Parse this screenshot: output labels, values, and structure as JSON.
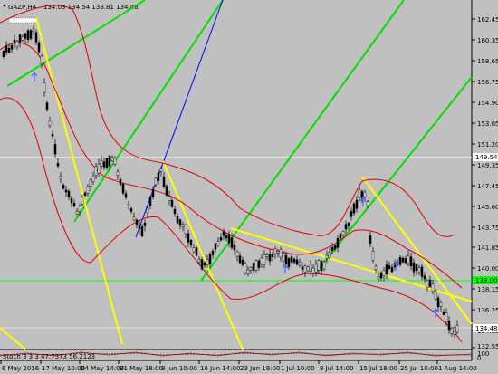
{
  "window": {
    "title": "GAZP,H4",
    "ohlc": "134.09 134.54 133.81 134.48"
  },
  "indicator": {
    "label": "Stoch 3 3 3 47.7573 56.2123"
  },
  "price_axis": {
    "ticks": [
      "162.45",
      "160.35",
      "158.65",
      "156.75",
      "154.90",
      "153.05",
      "151.20",
      "149.35",
      "147.45",
      "145.60",
      "143.75",
      "141.85",
      "140.00",
      "138.15",
      "136.25",
      "134.35",
      "132.55"
    ],
    "badges": {
      "level_white": "149.54",
      "level_green": "139.00",
      "current": "134.48"
    },
    "sub_ticks": [
      "100",
      "0"
    ]
  },
  "time_axis": {
    "labels": [
      "6 May 2016",
      "17 May 10:00",
      "24 May 14:00",
      "31 May 18:00",
      "8 Jun 10:00",
      "16 Jun 14:00",
      "23 Jun 18:00",
      "1 Jul 10:00",
      "8 Jul 14:00",
      "15 Jul 18:00",
      "25 Jul 10:00",
      "1 Aug 14:00"
    ]
  },
  "colors": {
    "background": "#c0c0c0",
    "candle": "#000000",
    "bollinger": "#e00000",
    "trend_green": "#00e000",
    "trend_yellow": "#ffff00",
    "trend_blue": "#0000ff",
    "level_white": "#ffffff",
    "level_green": "#00ff00",
    "arrow": "#4a6cff"
  }
}
